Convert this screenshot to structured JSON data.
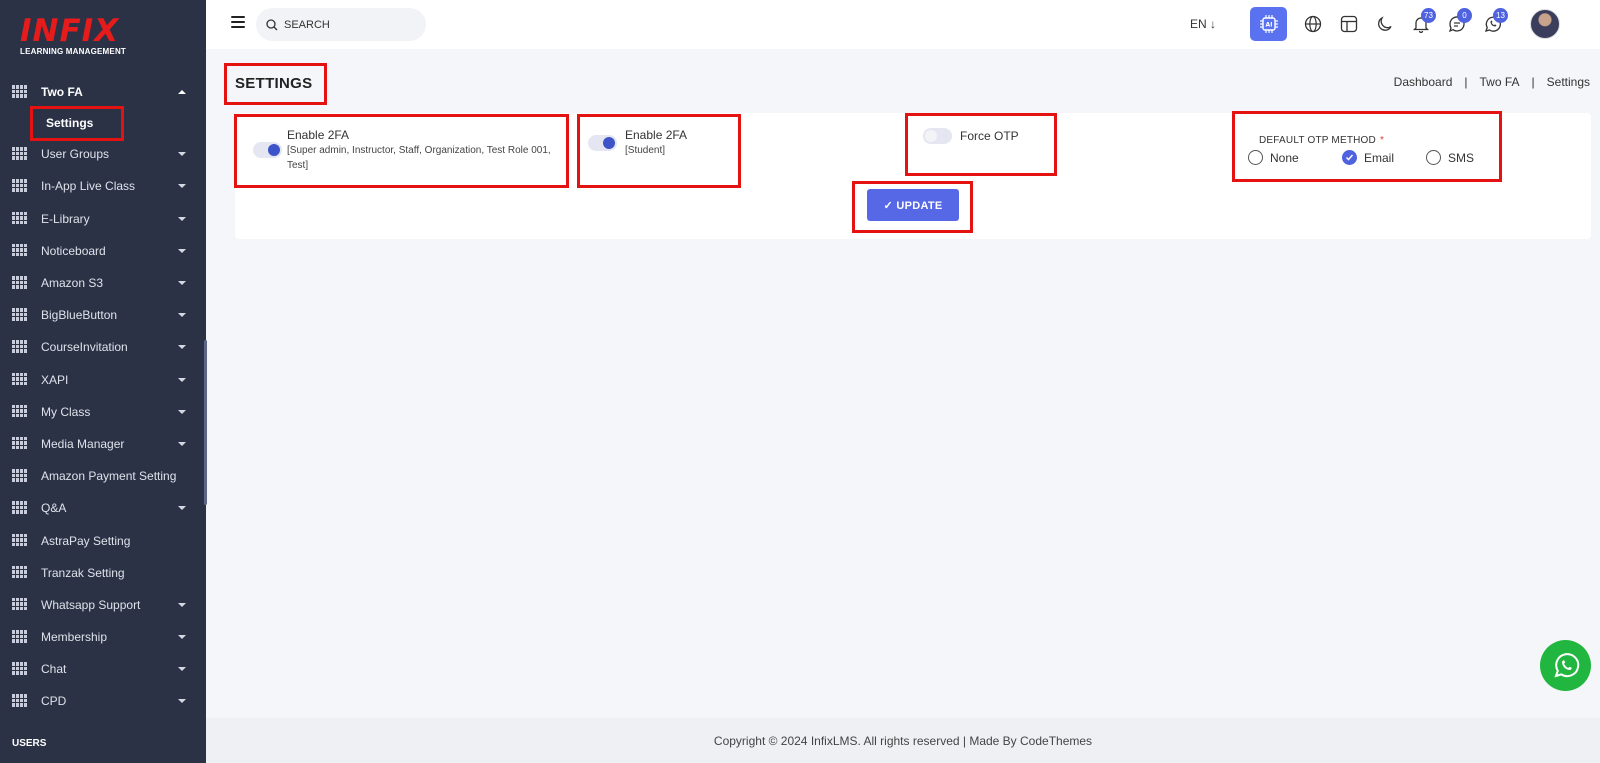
{
  "logo": {
    "main": "INFIX",
    "sub": "LEARNING MANAGEMENT"
  },
  "sidebar": {
    "active_item": "Two FA",
    "active_sub": "Settings",
    "items": [
      "User Groups",
      "In-App Live Class",
      "E-Library",
      "Noticeboard",
      "Amazon S3",
      "BigBlueButton",
      "CourseInvitation",
      "XAPI",
      "My Class",
      "Media Manager",
      "Amazon Payment Setting",
      "Q&A",
      "AstraPay Setting",
      "Tranzak Setting",
      "Whatsapp Support",
      "Membership",
      "Chat",
      "CPD"
    ],
    "section_label": "USERS"
  },
  "topbar": {
    "search_placeholder": "SEARCH",
    "language": "EN ↓",
    "ai_label": "AI",
    "notifications_count": "73",
    "messages_count": "0",
    "whatsapp_count": "13"
  },
  "page": {
    "title": "SETTINGS",
    "breadcrumb": [
      "Dashboard",
      "Two FA",
      "Settings"
    ]
  },
  "settings": {
    "enable_2fa_staff_label": "Enable 2FA",
    "enable_2fa_staff_roles_line1": "[Super admin, Instructor, Staff, Organization, Test Role 001,",
    "enable_2fa_staff_roles_line2": "Test]",
    "enable_2fa_staff_on": true,
    "enable_2fa_student_label": "Enable 2FA",
    "enable_2fa_student_roles": "[Student]",
    "enable_2fa_student_on": true,
    "force_otp_label": "Force OTP",
    "force_otp_on": false,
    "default_otp_label": "DEFAULT OTP METHOD",
    "required_mark": "*",
    "otp_options": [
      "None",
      "Email",
      "SMS"
    ],
    "otp_selected": "Email",
    "update_label": "✓ UPDATE"
  },
  "footer": {
    "text": "Copyright © 2024 InfixLMS. All rights reserved | Made By CodeThemes"
  },
  "colors": {
    "sidebar_bg": "#2b3245",
    "accent": "#5668e6",
    "annotation": "#e51212",
    "whatsapp": "#21b63f"
  }
}
